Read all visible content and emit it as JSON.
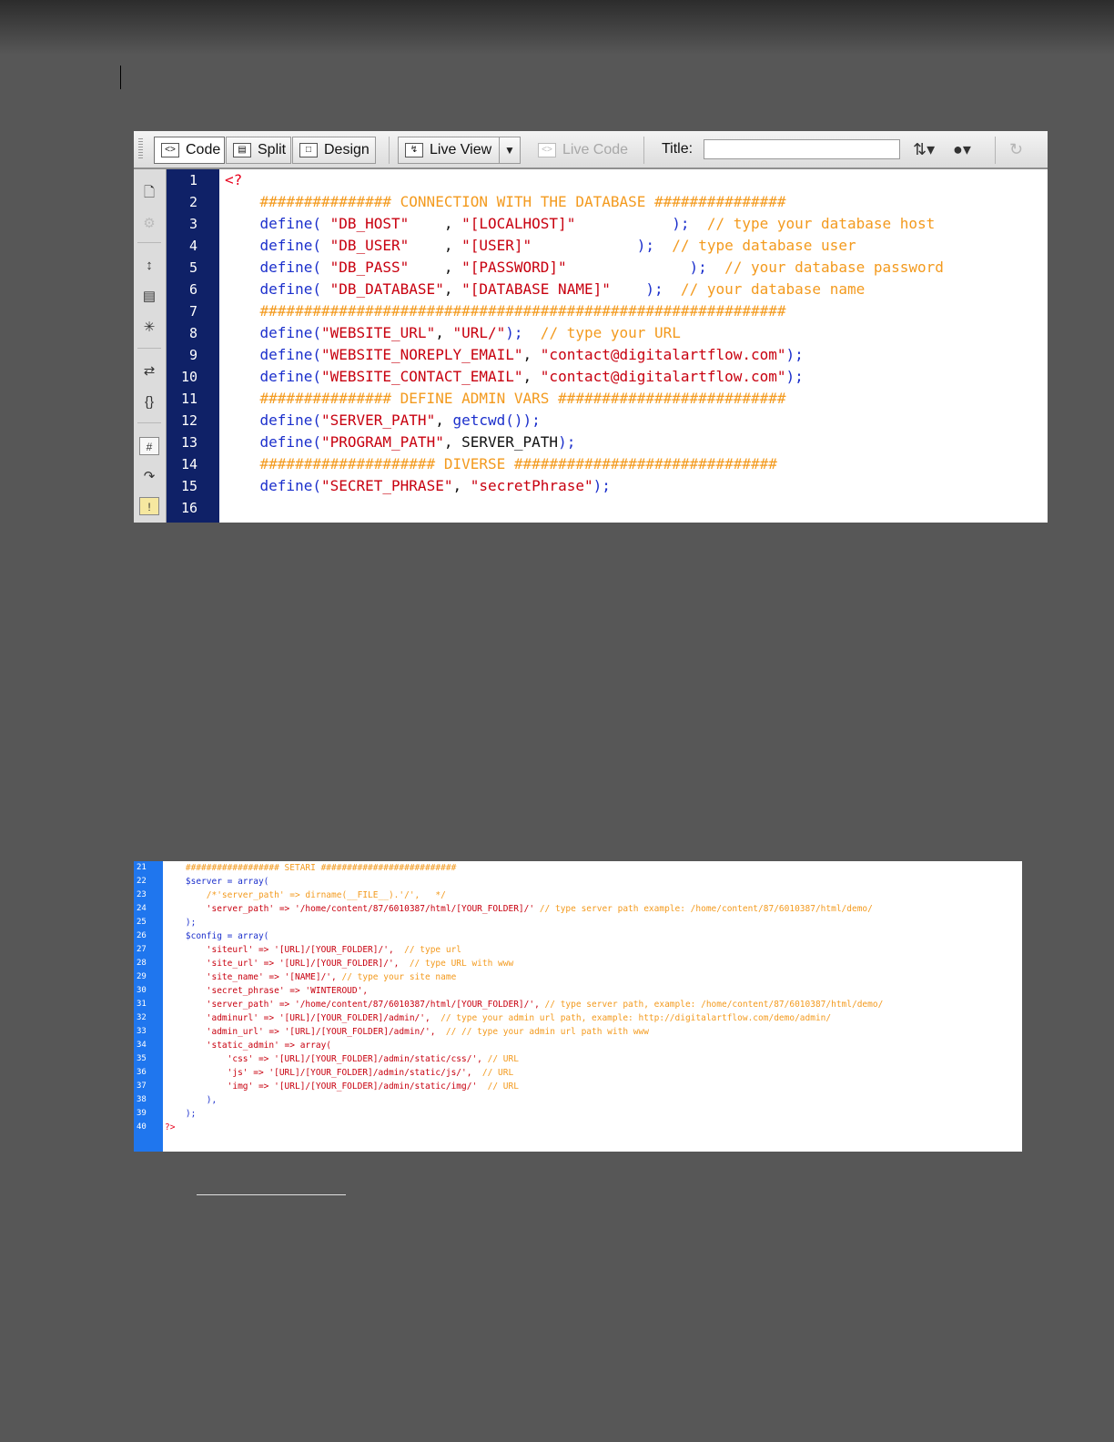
{
  "toolbar": {
    "code_label": "Code",
    "split_label": "Split",
    "design_label": "Design",
    "liveview_label": "Live View",
    "livecode_label": "Live Code",
    "title_label": "Title:",
    "title_value": ""
  },
  "editor1": {
    "lines": [
      {
        "n": "1",
        "code": [
          {
            "t": "<?",
            "c": "p"
          }
        ]
      },
      {
        "n": "2",
        "code": [
          {
            "t": "    ############### CONNECTION WITH THE DATABASE ###############",
            "c": "c"
          }
        ]
      },
      {
        "n": "3",
        "code": [
          {
            "t": "    define( ",
            "c": "k"
          },
          {
            "t": "\"DB_HOST\"",
            "c": "s"
          },
          {
            "t": "    , ",
            "c": "t"
          },
          {
            "t": "\"[LOCALHOST]\"",
            "c": "s"
          },
          {
            "t": "           ); ",
            "c": "k"
          },
          {
            "t": " // type your database host",
            "c": "c"
          }
        ]
      },
      {
        "n": "4",
        "code": [
          {
            "t": "    define( ",
            "c": "k"
          },
          {
            "t": "\"DB_USER\"",
            "c": "s"
          },
          {
            "t": "    , ",
            "c": "t"
          },
          {
            "t": "\"[USER]\"",
            "c": "s"
          },
          {
            "t": "            ); ",
            "c": "k"
          },
          {
            "t": " // type database user",
            "c": "c"
          }
        ]
      },
      {
        "n": "5",
        "code": [
          {
            "t": "    define( ",
            "c": "k"
          },
          {
            "t": "\"DB_PASS\"",
            "c": "s"
          },
          {
            "t": "    , ",
            "c": "t"
          },
          {
            "t": "\"[PASSWORD]\"",
            "c": "s"
          },
          {
            "t": "              ); ",
            "c": "k"
          },
          {
            "t": " // your database password",
            "c": "c"
          }
        ]
      },
      {
        "n": "6",
        "code": [
          {
            "t": "    define( ",
            "c": "k"
          },
          {
            "t": "\"DB_DATABASE\"",
            "c": "s"
          },
          {
            "t": ", ",
            "c": "t"
          },
          {
            "t": "\"[DATABASE NAME]\"",
            "c": "s"
          },
          {
            "t": "    ); ",
            "c": "k"
          },
          {
            "t": " // your database name",
            "c": "c"
          }
        ]
      },
      {
        "n": "7",
        "code": [
          {
            "t": "    ############################################################",
            "c": "c"
          }
        ]
      },
      {
        "n": "8",
        "code": [
          {
            "t": "    define(",
            "c": "k"
          },
          {
            "t": "\"WEBSITE_URL\"",
            "c": "s"
          },
          {
            "t": ", ",
            "c": "t"
          },
          {
            "t": "\"URL/\"",
            "c": "s"
          },
          {
            "t": "); ",
            "c": "k"
          },
          {
            "t": " // type your URL",
            "c": "c"
          }
        ]
      },
      {
        "n": "9",
        "code": [
          {
            "t": "    define(",
            "c": "k"
          },
          {
            "t": "\"WEBSITE_NOREPLY_EMAIL\"",
            "c": "s"
          },
          {
            "t": ", ",
            "c": "t"
          },
          {
            "t": "\"contact@digitalartflow.com\"",
            "c": "s"
          },
          {
            "t": ");",
            "c": "k"
          }
        ]
      },
      {
        "n": "10",
        "code": [
          {
            "t": "    define(",
            "c": "k"
          },
          {
            "t": "\"WEBSITE_CONTACT_EMAIL\"",
            "c": "s"
          },
          {
            "t": ", ",
            "c": "t"
          },
          {
            "t": "\"contact@digitalartflow.com\"",
            "c": "s"
          },
          {
            "t": ");",
            "c": "k"
          }
        ]
      },
      {
        "n": "11",
        "code": [
          {
            "t": "    ############### DEFINE ADMIN VARS ##########################",
            "c": "c"
          }
        ]
      },
      {
        "n": "12",
        "code": [
          {
            "t": "    define(",
            "c": "k"
          },
          {
            "t": "\"SERVER_PATH\"",
            "c": "s"
          },
          {
            "t": ", ",
            "c": "t"
          },
          {
            "t": "getcwd());",
            "c": "k"
          }
        ]
      },
      {
        "n": "13",
        "code": [
          {
            "t": "    define(",
            "c": "k"
          },
          {
            "t": "\"PROGRAM_PATH\"",
            "c": "s"
          },
          {
            "t": ", SERVER_PATH",
            "c": "t"
          },
          {
            "t": ");",
            "c": "k"
          }
        ]
      },
      {
        "n": "14",
        "code": [
          {
            "t": "    #################### DIVERSE ##############################",
            "c": "c"
          }
        ]
      },
      {
        "n": "15",
        "code": [
          {
            "t": "    define(",
            "c": "k"
          },
          {
            "t": "\"SECRET_PHRASE\"",
            "c": "s"
          },
          {
            "t": ", ",
            "c": "t"
          },
          {
            "t": "\"secretPhrase\"",
            "c": "s"
          },
          {
            "t": ");",
            "c": "k"
          }
        ]
      },
      {
        "n": "16",
        "code": []
      }
    ]
  },
  "editor2": {
    "lines": [
      {
        "n": "21",
        "code": [
          {
            "t": "    ################## SETARI ##########################",
            "c": "c"
          }
        ]
      },
      {
        "n": "22",
        "code": [
          {
            "t": "    $server = array(",
            "c": "k"
          }
        ]
      },
      {
        "n": "23",
        "code": [
          {
            "t": "        /*'server_path' => dirname(__FILE__).'/',   */",
            "c": "c"
          }
        ]
      },
      {
        "n": "24",
        "code": [
          {
            "t": "        'server_path' => '/home/content/87/6010387/html/[YOUR_FOLDER]/'",
            "c": "s"
          },
          {
            "t": " // type server path example: /home/content/87/6010387/html/demo/",
            "c": "c"
          }
        ]
      },
      {
        "n": "25",
        "code": [
          {
            "t": "    );",
            "c": "k"
          }
        ]
      },
      {
        "n": "26",
        "code": [
          {
            "t": "    $config = array(",
            "c": "k"
          }
        ]
      },
      {
        "n": "27",
        "code": [
          {
            "t": "        'siteurl' => '[URL]/[YOUR_FOLDER]/',",
            "c": "s"
          },
          {
            "t": "  // type url",
            "c": "c"
          }
        ]
      },
      {
        "n": "28",
        "code": [
          {
            "t": "        'site_url' => '[URL]/[YOUR_FOLDER]/',",
            "c": "s"
          },
          {
            "t": "  // type URL with www",
            "c": "c"
          }
        ]
      },
      {
        "n": "29",
        "code": [
          {
            "t": "        'site_name' => '[NAME]/',",
            "c": "s"
          },
          {
            "t": " // type your site name",
            "c": "c"
          }
        ]
      },
      {
        "n": "30",
        "code": [
          {
            "t": "        'secret_phrase' => 'WINTEROUD',",
            "c": "s"
          }
        ]
      },
      {
        "n": "31",
        "code": [
          {
            "t": "        'server_path' => '/home/content/87/6010387/html/[YOUR_FOLDER]/',",
            "c": "s"
          },
          {
            "t": " // type server path, example: /home/content/87/6010387/html/demo/",
            "c": "c"
          }
        ]
      },
      {
        "n": "32",
        "code": [
          {
            "t": "        'adminurl' => '[URL]/[YOUR_FOLDER]/admin/',",
            "c": "s"
          },
          {
            "t": "  // type your admin url path, example: http://digitalartflow.com/demo/admin/",
            "c": "c"
          }
        ]
      },
      {
        "n": "33",
        "code": [
          {
            "t": "        'admin_url' => '[URL]/[YOUR_FOLDER]/admin/',",
            "c": "s"
          },
          {
            "t": "  // // type your admin url path with www",
            "c": "c"
          }
        ]
      },
      {
        "n": "34",
        "code": [
          {
            "t": "        'static_admin' => array(",
            "c": "s"
          }
        ]
      },
      {
        "n": "35",
        "code": [
          {
            "t": "            'css' => '[URL]/[YOUR_FOLDER]/admin/static/css/',",
            "c": "s"
          },
          {
            "t": " // URL",
            "c": "c"
          }
        ]
      },
      {
        "n": "36",
        "code": [
          {
            "t": "            'js' => '[URL]/[YOUR_FOLDER]/admin/static/js/',",
            "c": "s"
          },
          {
            "t": "  // URL",
            "c": "c"
          }
        ]
      },
      {
        "n": "37",
        "code": [
          {
            "t": "            'img' => '[URL]/[YOUR_FOLDER]/admin/static/img/'",
            "c": "s"
          },
          {
            "t": "  // URL",
            "c": "c"
          }
        ]
      },
      {
        "n": "38",
        "code": [
          {
            "t": "        ),",
            "c": "k"
          }
        ]
      },
      {
        "n": "39",
        "code": [
          {
            "t": "    );",
            "c": "k"
          }
        ]
      },
      {
        "n": "40",
        "code": [
          {
            "t": "?>",
            "c": "p"
          }
        ]
      }
    ]
  },
  "colors": {
    "keyword": "#1b2fcc",
    "string": "#c8000f",
    "comment": "#f39a1e",
    "gutter1": "#0f2167",
    "gutter2": "#1f76ee",
    "page": "#575757"
  },
  "sidebar_icons": [
    "document-icon",
    "gear-icon",
    "expand-collapse-icon",
    "collapse-selection-icon",
    "expand-all-icon",
    "indent-icon",
    "braces-icon",
    "line-numbers-icon",
    "wrap-icon",
    "warning-icon"
  ]
}
